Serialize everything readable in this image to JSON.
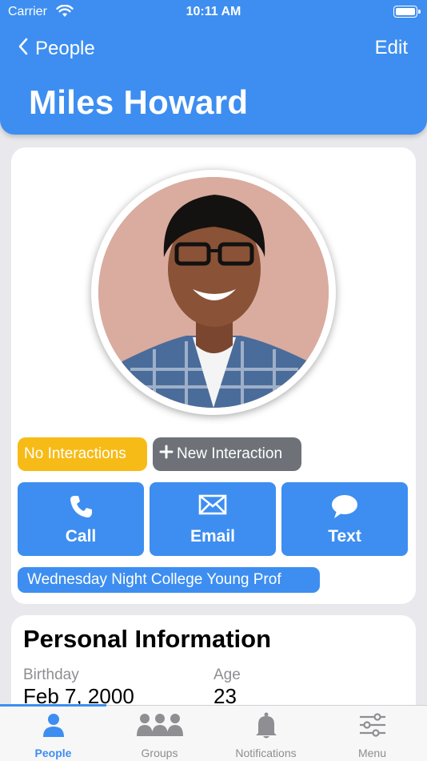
{
  "status_bar": {
    "carrier": "Carrier",
    "time": "10:11 AM"
  },
  "nav": {
    "back_label": "People",
    "edit_label": "Edit"
  },
  "title": "Miles Howard",
  "badges": {
    "no_interactions": "No Interactions",
    "new_interaction": "New Interaction"
  },
  "actions": [
    {
      "label": "Call",
      "icon": "phone-icon"
    },
    {
      "label": "Email",
      "icon": "envelope-icon"
    },
    {
      "label": "Text",
      "icon": "chat-bubble-icon"
    }
  ],
  "group_tag": "Wednesday Night College Young Prof",
  "personal_info": {
    "heading": "Personal Information",
    "birthday_label": "Birthday",
    "birthday_value": "Feb 7, 2000",
    "age_label": "Age",
    "age_value": "23"
  },
  "tabs": [
    {
      "label": "People",
      "icon": "person-icon",
      "active": true
    },
    {
      "label": "Groups",
      "icon": "group-icon",
      "active": false
    },
    {
      "label": "Notifications",
      "icon": "bell-icon",
      "active": false
    },
    {
      "label": "Menu",
      "icon": "sliders-icon",
      "active": false
    }
  ],
  "colors": {
    "accent": "#3d8ef0",
    "warning": "#f7bb17",
    "neutral": "#6e7278"
  }
}
